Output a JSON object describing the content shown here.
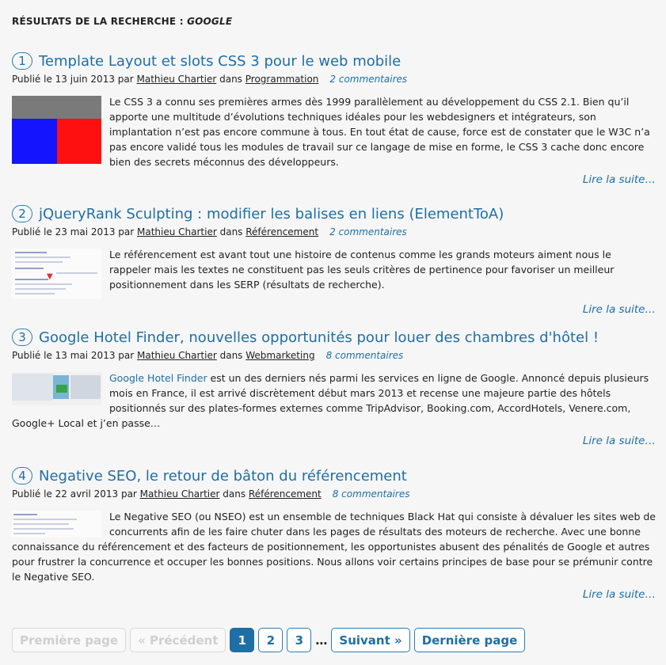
{
  "search": {
    "prefix": "RÉSULTATS DE LA RECHERCHE : ",
    "query": "GOOGLE"
  },
  "articles": [
    {
      "number": "1",
      "title": "Template Layout et slots CSS 3 pour le web mobile",
      "published_prefix": "Publié le 13 juin 2013 par ",
      "author": "Mathieu Chartier",
      "in": " dans ",
      "category": "Programmation",
      "comments": "2 commentaires",
      "excerpt": "Le CSS 3 a connu ses premières armes dès 1999 parallèlement au développement du CSS 2.1. Bien qu’il apporte une multitude d’évolutions techniques idéales pour les webdesigners et intégrateurs, son implantation n’est pas encore commune à tous. En tout état de cause, force est de constater que le W3C n’a pas encore validé tous les modules de travail sur ce langage de mise en forme, le CSS 3 cache donc encore bien des secrets méconnus des développeurs.",
      "read_more": "Lire la suite…"
    },
    {
      "number": "2",
      "title": "jQueryRank Sculpting : modifier les balises en liens (ElementToA)",
      "published_prefix": "Publié le 23 mai 2013 par ",
      "author": "Mathieu Chartier",
      "in": " dans ",
      "category": "Référencement",
      "comments": "2 commentaires",
      "excerpt": "Le référencement est avant tout une histoire de contenus comme les grands moteurs aiment nous le rappeler mais les textes ne constituent pas les seuls critères de pertinence pour favoriser un meilleur positionnement dans les SERP (résultats de recherche).",
      "read_more": "Lire la suite…"
    },
    {
      "number": "3",
      "title": "Google Hotel Finder, nouvelles opportunités pour louer des chambres d'hôtel !",
      "published_prefix": "Publié le 13 mai 2013 par ",
      "author": "Mathieu Chartier",
      "in": " dans ",
      "category": "Webmarketing",
      "comments": "8 commentaires",
      "excerpt_link": "Google Hotel Finder",
      "excerpt": " est un des derniers nés parmi les services en ligne de Google. Annoncé depuis plusieurs mois en France, il est arrivé discrètement début mars 2013 et recense une majeure partie des hôtels positionnés sur des plates-formes externes comme TripAdvisor, Booking.com, AccordHotels, Venere.com, Google+ Local et j’en passe…",
      "read_more": "Lire la suite…"
    },
    {
      "number": "4",
      "title": "Negative SEO, le retour de bâton du référencement",
      "published_prefix": "Publié le 22 avril 2013 par ",
      "author": "Mathieu Chartier",
      "in": " dans ",
      "category": "Référencement",
      "comments": "8 commentaires",
      "excerpt": "Le Negative SEO (ou NSEO) est un ensemble de techniques Black Hat qui consiste à dévaluer les sites web de concurrents afin de les faire chuter dans les pages de résultats des moteurs de recherche. Avec une bonne connaissance du référencement et des facteurs de positionnement, les opportunistes abusent des pénalités de Google et autres pour frustrer la concurrence et occuper les bonnes positions. Nous allons voir certains principes de base pour se prémunir contre le Negative SEO.",
      "read_more": "Lire la suite…"
    }
  ],
  "pagination": {
    "first": "Première page",
    "prev": "« Précédent",
    "pages": [
      "1",
      "2",
      "3"
    ],
    "current": "1",
    "ellipsis": "…",
    "next": "Suivant »",
    "last": "Dernière page"
  },
  "colors": {
    "accent": "#1e6fa5",
    "background": "#f6f6f6"
  }
}
